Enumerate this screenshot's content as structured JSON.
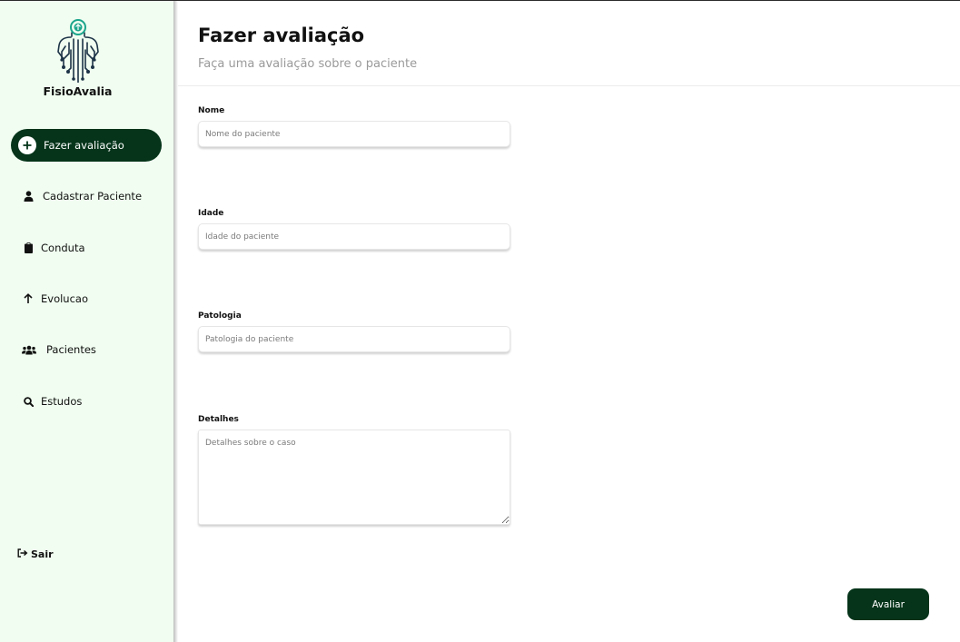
{
  "app": {
    "brand": "FisioAvalia"
  },
  "sidebar": {
    "items": [
      {
        "label": "Fazer avaliação",
        "icon": "plus-circle-icon",
        "active": true
      },
      {
        "label": "Cadastrar Paciente",
        "icon": "user-icon",
        "active": false
      },
      {
        "label": "Conduta",
        "icon": "clipboard-icon",
        "active": false
      },
      {
        "label": "Evolucao",
        "icon": "arrow-up-icon",
        "active": false
      },
      {
        "label": "Pacientes",
        "icon": "users-icon",
        "active": false
      },
      {
        "label": "Estudos",
        "icon": "search-icon",
        "active": false
      }
    ],
    "logout_label": "Sair",
    "logout_icon": "sign-out-icon"
  },
  "header": {
    "title": "Fazer avaliação",
    "subtitle": "Faça uma avaliação sobre o paciente"
  },
  "form": {
    "name": {
      "label": "Nome",
      "placeholder": "Nome do paciente",
      "value": ""
    },
    "age": {
      "label": "Idade",
      "placeholder": "Idade do paciente",
      "value": ""
    },
    "pathology": {
      "label": "Patologia",
      "placeholder": "Patologia do paciente",
      "value": ""
    },
    "details": {
      "label": "Detalhes",
      "placeholder": "Detalhes sobre o caso",
      "value": ""
    },
    "submit_label": "Avaliar"
  },
  "colors": {
    "sidebar_bg": "#f0fdf0",
    "accent": "#05341a",
    "logo_teal": "#1ba58c",
    "logo_dark": "#1d3347"
  }
}
